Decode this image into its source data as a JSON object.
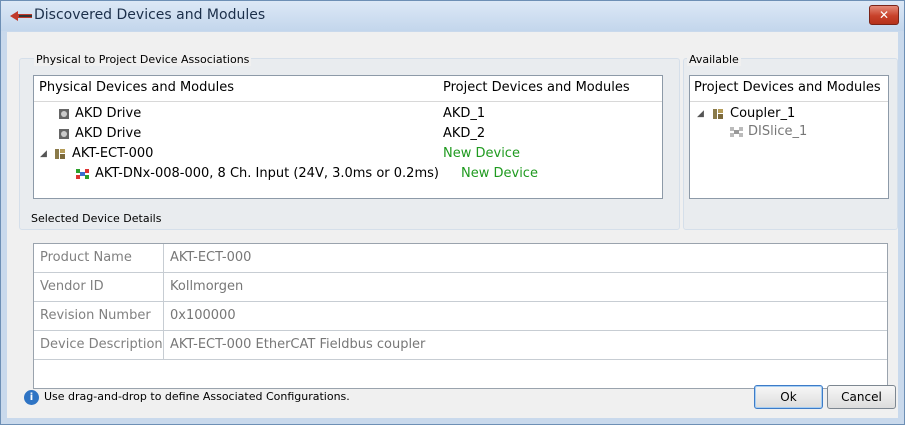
{
  "window": {
    "title": "Discovered Devices and Modules",
    "close_label": "✕"
  },
  "associations": {
    "group_label": "Physical to Project Device Associations",
    "col_physical": "Physical Devices and Modules",
    "col_project": "Project Devices and Modules",
    "rows": [
      {
        "physical": "AKD Drive",
        "project": "AKD_1"
      },
      {
        "physical": "AKD Drive",
        "project": "AKD_2"
      },
      {
        "physical": "AKT-ECT-000",
        "project": "New Device"
      },
      {
        "physical": "AKT-DNx-008-000, 8 Ch. Input (24V, 3.0ms or 0.2ms)",
        "project": "New Device"
      }
    ]
  },
  "available": {
    "group_label": "Available",
    "header": "Project Devices and Modules",
    "items": [
      {
        "label": "Coupler_1"
      },
      {
        "label": "DISlice_1"
      }
    ]
  },
  "details": {
    "group_label": "Selected Device Details",
    "rows": [
      {
        "label": "Product Name",
        "value": "AKT-ECT-000"
      },
      {
        "label": "Vendor ID",
        "value": "Kollmorgen"
      },
      {
        "label": "Revision Number",
        "value": "0x100000"
      },
      {
        "label": "Device Description",
        "value": "AKT-ECT-000 EtherCAT Fieldbus coupler"
      }
    ]
  },
  "footer": {
    "info_text": "Use drag-and-drop to define Associated Configurations.",
    "ok_label": "Ok",
    "cancel_label": "Cancel"
  },
  "colors": {
    "new_device": "#1f9a1f",
    "accent": "#2f74c4"
  },
  "icons": [
    "app-logo-icon",
    "close-icon",
    "drive-icon",
    "coupler-icon",
    "io-module-icon",
    "slice-icon",
    "expand-arrow-icon",
    "info-icon"
  ]
}
